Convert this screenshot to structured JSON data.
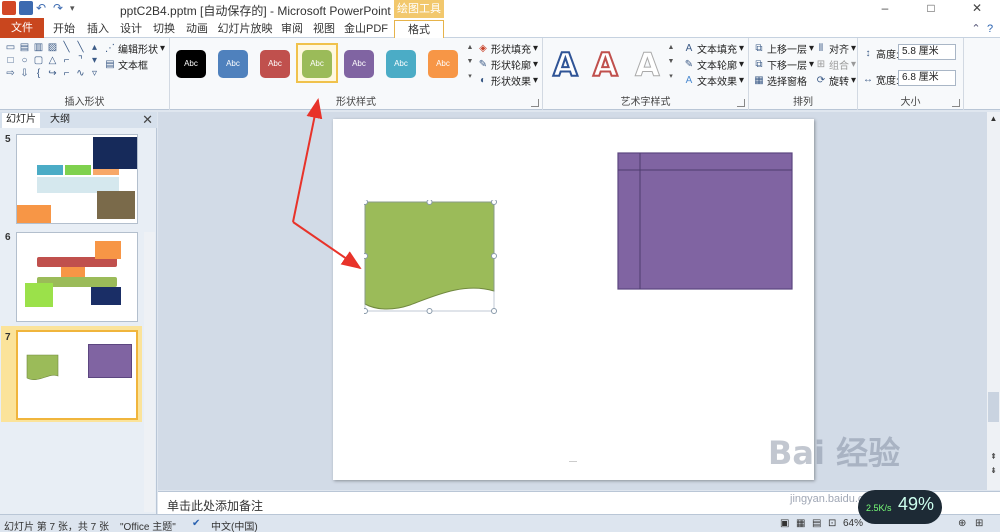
{
  "window": {
    "title": "pptC2B4.pptm [自动保存的] - Microsoft PowerPoint",
    "drawing_tools_label": "绘图工具",
    "minimize": "–",
    "maximize": "□",
    "close": "✕"
  },
  "tabs": [
    {
      "label": "文件"
    },
    {
      "label": "开始"
    },
    {
      "label": "插入"
    },
    {
      "label": "设计"
    },
    {
      "label": "切换"
    },
    {
      "label": "动画"
    },
    {
      "label": "幻灯片放映"
    },
    {
      "label": "审阅"
    },
    {
      "label": "视图"
    },
    {
      "label": "金山PDF"
    },
    {
      "label": "格式"
    }
  ],
  "ribbon": {
    "insert_shapes": {
      "label": "插入形状",
      "edit_shape": "编辑形状",
      "text_box": "文本框"
    },
    "shape_styles": {
      "label": "形状样式",
      "swatch_text": "Abc",
      "fill": "形状填充",
      "outline": "形状轮廓",
      "effects": "形状效果",
      "swatch_colors": [
        "#000000",
        "#4f81bd",
        "#c0504d",
        "#9bbb59",
        "#8064a2",
        "#4bacc6",
        "#f79646"
      ],
      "selected_index": 3
    },
    "wordart": {
      "label": "艺术字样式",
      "letter": "A",
      "text_fill": "文本填充",
      "text_outline": "文本轮廓",
      "text_effects": "文本效果"
    },
    "arrange": {
      "label": "排列",
      "bring_forward": "上移一层",
      "send_backward": "下移一层",
      "selection_pane": "选择窗格",
      "align": "对齐",
      "group": "组合",
      "rotate": "旋转"
    },
    "size": {
      "label": "大小",
      "height_label": "高度:",
      "height_value": "5.8 厘米",
      "width_label": "宽度:",
      "width_value": "6.8 厘米"
    }
  },
  "slide_pane": {
    "tabs": [
      "幻灯片",
      "大纲"
    ],
    "close": "✕",
    "slides": [
      {
        "number": "5"
      },
      {
        "number": "6"
      },
      {
        "number": "7"
      }
    ]
  },
  "canvas": {
    "notes_placeholder": "单击此处添加备注",
    "green_shape_color": "#9bbb59",
    "purple_shape_color": "#8064a2",
    "arrow_color": "#e8332a"
  },
  "statusbar": {
    "slide_info": "幻灯片 第 7 张，共 7 张",
    "theme": "\"Office 主题\"",
    "language": "中文(中国)",
    "zoom": "64%"
  },
  "overlay": {
    "watermark": "Bai 经验",
    "watermark_url": "jingyan.baidu.com",
    "speed_percent": "49%",
    "speed_rate": "2.5K/s"
  }
}
